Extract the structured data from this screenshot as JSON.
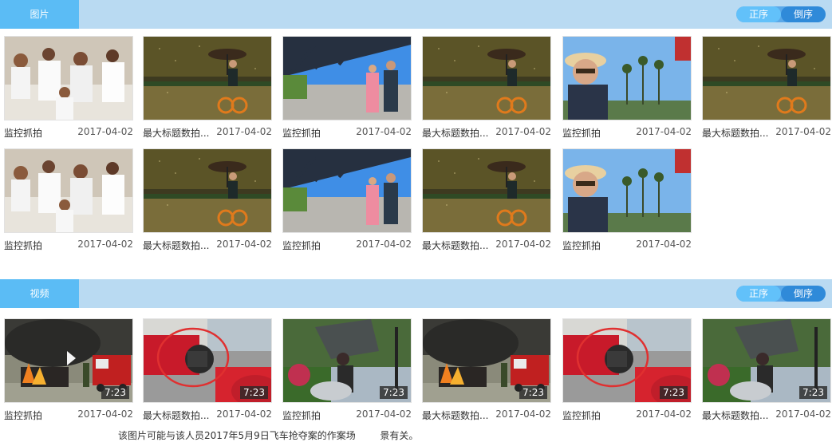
{
  "images_section": {
    "tab_label": "图片",
    "sort_asc": "正序",
    "sort_desc": "倒序",
    "items": [
      {
        "title": "监控抓拍",
        "date": "2017-04-02",
        "scene": "crowd"
      },
      {
        "title": "最大标题数拍...",
        "date": "2017-04-02",
        "scene": "umbrella"
      },
      {
        "title": "监控抓拍",
        "date": "2017-04-02",
        "scene": "bridge"
      },
      {
        "title": "最大标题数拍...",
        "date": "2017-04-02",
        "scene": "umbrella"
      },
      {
        "title": "监控抓拍",
        "date": "2017-04-02",
        "scene": "selfie"
      },
      {
        "title": "最大标题数拍...",
        "date": "2017-04-02",
        "scene": "umbrella"
      },
      {
        "title": "监控抓拍",
        "date": "2017-04-02",
        "scene": "crowd"
      },
      {
        "title": "最大标题数拍...",
        "date": "2017-04-02",
        "scene": "umbrella"
      },
      {
        "title": "监控抓拍",
        "date": "2017-04-02",
        "scene": "bridge"
      },
      {
        "title": "最大标题数拍...",
        "date": "2017-04-02",
        "scene": "umbrella"
      },
      {
        "title": "监控抓拍",
        "date": "2017-04-02",
        "scene": "selfie"
      }
    ]
  },
  "videos_section": {
    "tab_label": "视频",
    "sort_asc": "正序",
    "sort_desc": "倒序",
    "items": [
      {
        "title": "监控抓拍",
        "date": "2017-04-02",
        "duration": "7:23",
        "scene": "fire",
        "playing": true
      },
      {
        "title": "最大标题数拍...",
        "date": "2017-04-02",
        "duration": "7:23",
        "scene": "crash",
        "playing": false
      },
      {
        "title": "监控抓拍",
        "date": "2017-04-02",
        "duration": "7:23",
        "scene": "storm",
        "playing": false
      },
      {
        "title": "最大标题数拍...",
        "date": "2017-04-02",
        "duration": "7:23",
        "scene": "fire",
        "playing": false
      },
      {
        "title": "监控抓拍",
        "date": "2017-04-02",
        "duration": "7:23",
        "scene": "crash",
        "playing": false
      },
      {
        "title": "最大标题数拍...",
        "date": "2017-04-02",
        "duration": "7:23",
        "scene": "storm",
        "playing": false
      }
    ]
  },
  "footnote": "该图片可能与该人员2017年5月9日飞车抢夺案的作案场        景有关。",
  "colors": {
    "header_bg": "#b9daf2",
    "tab_bg": "#5bbcf5",
    "toggle_active": "#62c1fa",
    "toggle_inactive": "#2f8ad9"
  }
}
